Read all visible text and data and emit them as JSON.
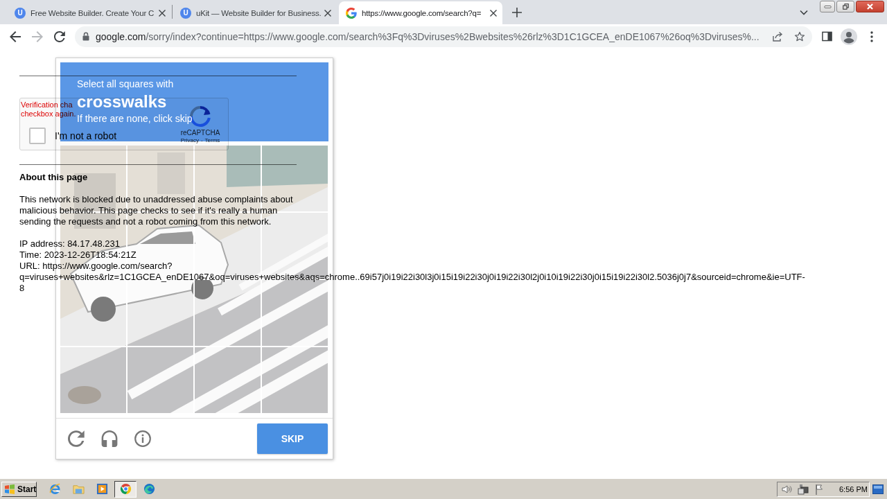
{
  "browser": {
    "tabs": [
      {
        "kind": "letter",
        "favicon_letter": "U",
        "title": "Free Website Builder. Create Your C",
        "selected": false
      },
      {
        "kind": "letter",
        "favicon_letter": "U",
        "title": "uKit — Website Builder for Business.",
        "selected": false
      },
      {
        "kind": "logo",
        "title": "https://www.google.com/search?q=",
        "selected": true
      }
    ],
    "nav": [
      {
        "kind": "back",
        "disabled": false
      },
      {
        "kind": "forward",
        "disabled": true
      },
      {
        "kind": "reload",
        "disabled": false
      }
    ],
    "address": {
      "host": "google.com",
      "path": "/sorry/index?continue=https://www.google.com/search%3Fq%3Dviruses%2Bwebsites%26rlz%3D1C1GCEA_enDE1067%26oq%3Dviruses%..."
    }
  },
  "page": {
    "widget": {
      "error_lines": [
        "Verification cha",
        "checkbox again."
      ],
      "checked": false,
      "label": "I'm not a robot",
      "brand": "reCAPTCHA",
      "privacy_link": "Privacy",
      "separator": "-",
      "terms_link": "Terms"
    },
    "about": {
      "heading": "About this page",
      "body": "This network is blocked due to unaddressed abuse complaints about malicious behavior. This page checks to see if it's really a human sending the requests and not a robot coming from this network.",
      "details": [
        "IP address: 84.17.48.231",
        "Time: 2023-12-26T18:54:21Z",
        "URL: https://www.google.com/search?",
        "q=viruses+websites&rlz=1C1GCEA_enDE1067&oq=viruses+websites&aqs=chrome..69i57j0i19i22i30l3j0i15i19i22i30j0i19i22i30l2j0i10i19i22i30j0i15i19i22i30l2.5036j0j7&sourceid=chrome&ie=UTF-",
        "8"
      ]
    }
  },
  "challenge": {
    "prompt": "Select all squares with",
    "target": "crosswalks",
    "hint": "If there are none, click skip",
    "tiles": [
      {
        "selected": false
      },
      {
        "selected": false
      },
      {
        "selected": false
      },
      {
        "selected": false
      },
      {
        "selected": false
      },
      {
        "selected": false
      },
      {
        "selected": false
      },
      {
        "selected": false
      },
      {
        "selected": false
      },
      {
        "selected": false
      },
      {
        "selected": false
      },
      {
        "selected": false
      },
      {
        "selected": false
      },
      {
        "selected": false
      },
      {
        "selected": false
      },
      {
        "selected": false
      }
    ],
    "skip_button": "SKIP"
  },
  "taskbar": {
    "start": "Start",
    "quick_launch": [
      {
        "kind": "ie",
        "selected": false
      },
      {
        "kind": "folder",
        "selected": false
      },
      {
        "kind": "player",
        "selected": false
      },
      {
        "kind": "chrome",
        "selected": true
      },
      {
        "kind": "edge",
        "selected": false
      }
    ],
    "clock": "6:56 PM"
  }
}
